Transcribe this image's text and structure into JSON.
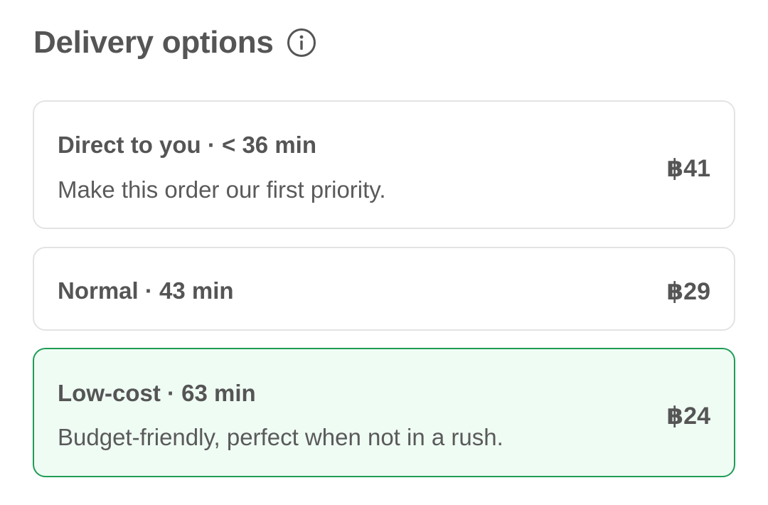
{
  "header": {
    "title": "Delivery options",
    "info_icon": "info-circle-icon"
  },
  "options": [
    {
      "title": "Direct to you · < 36 min",
      "description": "Make this order our first priority.",
      "price": "฿41",
      "selected": false
    },
    {
      "title": "Normal · 43 min",
      "price": "฿29",
      "selected": false
    },
    {
      "title": "Low-cost · 63 min",
      "description": "Budget-friendly, perfect when not in a rush.",
      "price": "฿24",
      "selected": true
    }
  ],
  "colors": {
    "selected_border": "#1f9d55",
    "selected_background": "#effcf4",
    "default_border": "#e3e3e3",
    "text": "#555555"
  }
}
